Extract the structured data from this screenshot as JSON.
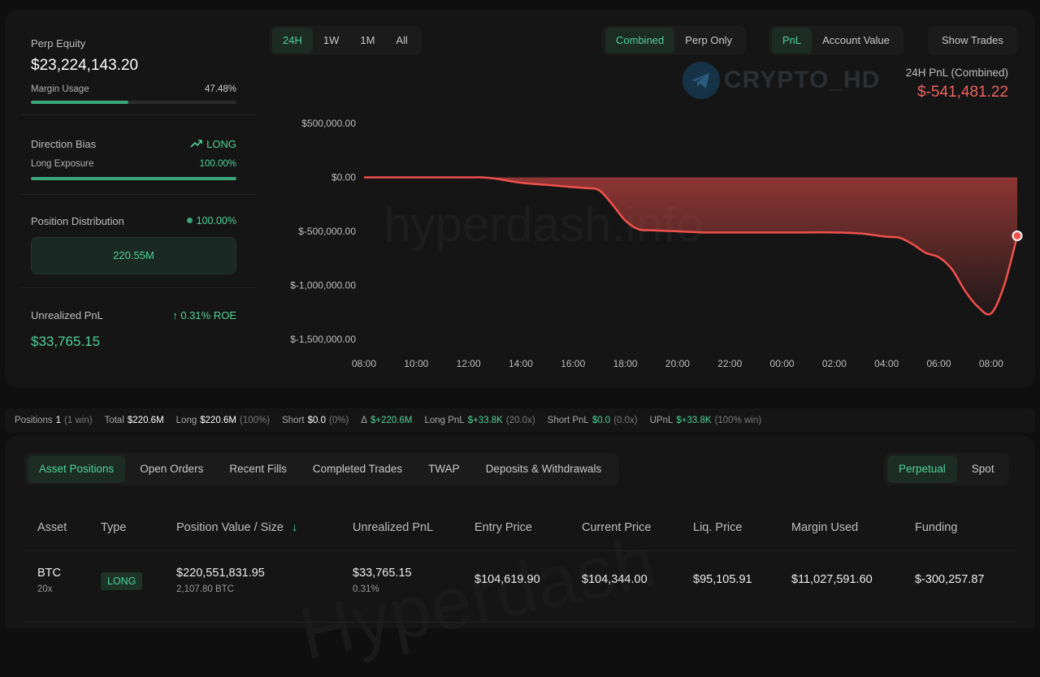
{
  "summary": {
    "perp_equity_label": "Perp Equity",
    "perp_equity_value": "$23,224,143.20",
    "margin_usage_label": "Margin Usage",
    "margin_usage_value": "47.48%",
    "margin_usage_fraction": 0.4748,
    "direction_bias_label": "Direction Bias",
    "direction_bias_value": "LONG",
    "long_exposure_label": "Long Exposure",
    "long_exposure_value": "100.00%",
    "long_exposure_fraction": 1.0,
    "position_distribution_label": "Position Distribution",
    "position_distribution_value": "100.00%",
    "position_distribution_amount": "220.55M",
    "unrealized_pnl_label": "Unrealized PnL",
    "roe_value": "0.31% ROE",
    "unrealized_pnl_value": "$33,765.15"
  },
  "range_tabs": [
    "24H",
    "1W",
    "1M",
    "All"
  ],
  "range_active": "24H",
  "mode_tabs": [
    "Combined",
    "Perp Only"
  ],
  "metric_tabs": [
    "PnL",
    "Account Value"
  ],
  "show_trades_label": "Show Trades",
  "pnl_summary": {
    "label": "24H PnL (Combined)",
    "value": "$-541,481.22"
  },
  "logo_text": "CRYPTO_HD",
  "watermark_text": "hyperdash.info",
  "chart_data": {
    "type": "area",
    "x": [
      "08:00",
      "09:00",
      "10:00",
      "11:00",
      "12:00",
      "12:30",
      "13:00",
      "14:00",
      "15:00",
      "16:00",
      "16:30",
      "17:00",
      "17:30",
      "18:00",
      "18:30",
      "19:00",
      "20:00",
      "21:00",
      "22:00",
      "23:00",
      "00:00",
      "01:00",
      "02:00",
      "03:00",
      "04:00",
      "04:30",
      "05:00",
      "05:30",
      "06:00",
      "06:30",
      "07:00",
      "07:30",
      "08:00",
      "08:30",
      "09:00"
    ],
    "y": [
      0,
      0,
      0,
      0,
      0,
      0,
      -10000,
      -50000,
      -70000,
      -90000,
      -100000,
      -120000,
      -250000,
      -400000,
      -480000,
      -490000,
      -500000,
      -510000,
      -510000,
      -510000,
      -510000,
      -510000,
      -510000,
      -520000,
      -550000,
      -560000,
      -620000,
      -700000,
      -740000,
      -850000,
      -1050000,
      -1200000,
      -1260000,
      -1000000,
      -541481
    ],
    "yticks": [
      "$500,000.00",
      "$0.00",
      "$-500,000.00",
      "$-1,000,000.00",
      "$-1,500,000.00"
    ],
    "xticks": [
      "08:00",
      "10:00",
      "12:00",
      "14:00",
      "16:00",
      "18:00",
      "20:00",
      "22:00",
      "00:00",
      "02:00",
      "04:00",
      "06:00",
      "08:00"
    ],
    "ylim": [
      -1500000,
      500000
    ],
    "color": "#f0504c"
  },
  "stats_bar": {
    "positions_label": "Positions",
    "positions_value": "1",
    "positions_note": "(1 win)",
    "total_label": "Total",
    "total_value": "$220.6M",
    "long_label": "Long",
    "long_value": "$220.6M",
    "long_note": "(100%)",
    "short_label": "Short",
    "short_value": "$0.0",
    "short_note": "(0%)",
    "delta_label": "Δ",
    "delta_value": "$+220.6M",
    "long_pnl_label": "Long PnL",
    "long_pnl_value": "$+33.8K",
    "long_pnl_note": "(20.0x)",
    "short_pnl_label": "Short PnL",
    "short_pnl_value": "$0.0",
    "short_pnl_note": "(0.0x)",
    "upnl_label": "UPnL",
    "upnl_value": "$+33.8K",
    "upnl_note": "(100% win)"
  },
  "bottom_tabs": [
    "Asset Positions",
    "Open Orders",
    "Recent Fills",
    "Completed Trades",
    "TWAP",
    "Deposits & Withdrawals"
  ],
  "bottom_tab_active": "Asset Positions",
  "market_tabs": [
    "Perpetual",
    "Spot"
  ],
  "market_tab_active": "Perpetual",
  "table": {
    "headers": [
      "Asset",
      "Type",
      "Position Value / Size",
      "Unrealized PnL",
      "Entry Price",
      "Current Price",
      "Liq. Price",
      "Margin Used",
      "Funding"
    ],
    "row": {
      "asset": "BTC",
      "leverage": "20x",
      "type": "LONG",
      "position_value": "$220,551,831.95",
      "position_size": "2,107.80 BTC",
      "unrealized_pnl": "$33,765.15",
      "unrealized_pct": "0.31%",
      "entry_price": "$104,619.90",
      "current_price": "$104,344.00",
      "liq_price": "$95,105.91",
      "margin_used": "$11,027,591.60",
      "funding": "$-300,257.87"
    }
  },
  "bottom_watermark": "Hyperdash"
}
